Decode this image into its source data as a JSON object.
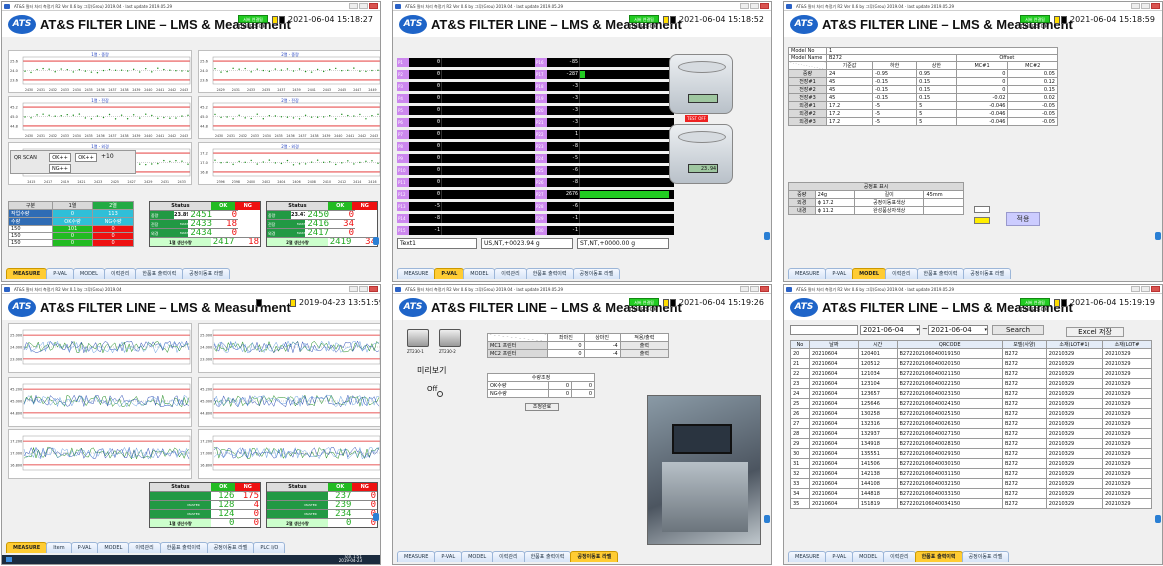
{
  "colors": {
    "accent_blue": "#1e64c8",
    "server_green": "#22cc22",
    "ok_green": "#229944",
    "ng_red": "#ee2222",
    "active_tab": "#ffcc33",
    "pval_label": "#cc88ee"
  },
  "common": {
    "window_title": "AT&S 필터 처리 측정기 R2 Ver 0.6 by 그루(Grou) 2019.04 · last update 2019.05.29",
    "window_title_short": "AT&S 필터 처리 측정기 R2 Ver 0.1 by 그루(Grou) 2019.04",
    "logo_text": "ATS",
    "app_title": "AT&S FILTER LINE – LMS & Measurment",
    "server_status": "서버 연결됨",
    "timer_status": "TIMER3-OK",
    "tabs": [
      "MEASURE",
      "P-VAL",
      "MODEL",
      "이력관리",
      "한품표 출력이력",
      "공정이동표 라벨"
    ]
  },
  "panels": [
    {
      "id": "measure",
      "datetime": "2021-06-04 15:18:27",
      "active_tab": "MEASURE",
      "charts": [
        {
          "title": "1열 - 중량",
          "ymin": "23.6",
          "ymid": "24.0",
          "ymax": "25.6",
          "xticks": [
            "2430",
            "2431",
            "2432",
            "2433",
            "2434",
            "2435",
            "2436",
            "2437",
            "2438",
            "2439",
            "2440",
            "2441",
            "2442",
            "2443"
          ]
        },
        {
          "title": "2열 - 중량",
          "ymin": "23.6",
          "ymid": "24.0",
          "ymax": "25.6",
          "xticks": [
            "2429",
            "2431",
            "2433",
            "2435",
            "2437",
            "2439",
            "2441",
            "2443",
            "2445",
            "2447",
            "2449"
          ]
        },
        {
          "title": "1열 - 전장",
          "ymin": "44.8",
          "ymid": "45.0",
          "ymax": "45.2",
          "xticks": [
            "2430",
            "2431",
            "2432",
            "2433",
            "2434",
            "2435",
            "2436",
            "2437",
            "2438",
            "2439",
            "2440",
            "2441",
            "2442",
            "2443"
          ]
        },
        {
          "title": "2열 - 전장",
          "ymin": "44.8",
          "ymid": "45.0",
          "ymax": "45.2",
          "xticks": [
            "2430",
            "2431",
            "2432",
            "2433",
            "2434",
            "2435",
            "2436",
            "2437",
            "2438",
            "2439",
            "2440",
            "2441",
            "2442",
            "2443"
          ]
        },
        {
          "title": "1열 - 외경",
          "ymin": "16.8",
          "ymid": "17.0",
          "ymax": "17.2",
          "xticks": [
            "2415",
            "2417",
            "2419",
            "2421",
            "2423",
            "2425",
            "2427",
            "2429",
            "2431",
            "2433"
          ]
        },
        {
          "title": "2열 - 외경",
          "ymin": "16.8",
          "ymid": "17.0",
          "ymax": "17.2",
          "xticks": [
            "2396",
            "2398",
            "2400",
            "2402",
            "2404",
            "2406",
            "2408",
            "2410",
            "2412",
            "2414",
            "2416"
          ]
        }
      ],
      "qr": {
        "label": "QR SCAN",
        "ok_btn": "OK++",
        "ok_btn2": "OK++",
        "ng_btn": "NG++",
        "step": "+10"
      },
      "count_table": {
        "headers": [
          "구분",
          "1열",
          "2열"
        ],
        "rows": [
          [
            "작업수량",
            "0",
            "113"
          ],
          [
            "수량",
            "OK수량",
            "NG수량"
          ],
          [
            "150",
            "101",
            "0"
          ],
          [
            "150",
            "0",
            "0"
          ],
          [
            "150",
            "0",
            "0"
          ]
        ]
      },
      "status1": {
        "title": "Status",
        "ok": "OK",
        "ng": "NG",
        "weight": "23.89",
        "rows": [
          [
            "중량",
            "2451",
            "0"
          ],
          [
            "전장",
            "MASTER",
            "2433",
            "18"
          ],
          [
            "외경",
            "MASTER",
            "2434",
            "0"
          ]
        ],
        "footer": "1열 생산수량",
        "total_ok": "2417",
        "total_ng": "18"
      },
      "status2": {
        "title": "Status",
        "ok": "OK",
        "ng": "NG",
        "weight": "23.47",
        "rows": [
          [
            "중량",
            "2450",
            "0"
          ],
          [
            "전장",
            "MASTER",
            "2416",
            "34"
          ],
          [
            "외경",
            "MASTER",
            "2417",
            "0"
          ]
        ],
        "footer": "2열 생산수량",
        "total_ok": "2419",
        "total_ng": "34"
      }
    },
    {
      "id": "pval",
      "datetime": "2021-06-04 15:18:52",
      "active_tab": "P-VAL",
      "left": [
        [
          "P1",
          "0"
        ],
        [
          "P2",
          "0"
        ],
        [
          "P3",
          "0"
        ],
        [
          "P4",
          "0"
        ],
        [
          "P5",
          "0"
        ],
        [
          "P6",
          "0"
        ],
        [
          "P7",
          "0"
        ],
        [
          "P8",
          "0"
        ],
        [
          "P9",
          "0"
        ],
        [
          "P10",
          "0"
        ],
        [
          "P11",
          "0"
        ],
        [
          "P12",
          "0"
        ],
        [
          "P13",
          "-5"
        ],
        [
          "P14",
          "-8"
        ],
        [
          "P15",
          "-1"
        ]
      ],
      "right": [
        [
          "P16",
          "-85"
        ],
        [
          "P17",
          "-287"
        ],
        [
          "P18",
          "-3"
        ],
        [
          "P19",
          "-3"
        ],
        [
          "P20",
          "-3"
        ],
        [
          "P21",
          "-3"
        ],
        [
          "P22",
          "1"
        ],
        [
          "P23",
          "-8"
        ],
        [
          "P24",
          "-5"
        ],
        [
          "P25",
          "-6"
        ],
        [
          "P26",
          "-8"
        ],
        [
          "P27",
          "2676"
        ],
        [
          "P28",
          "-6"
        ],
        [
          "P29",
          "-1"
        ],
        [
          "P30",
          "-1"
        ]
      ],
      "right_fill": [
        0,
        0.05,
        0,
        0,
        0,
        0,
        0,
        0,
        0,
        0,
        0,
        0.95,
        0,
        0,
        0
      ],
      "scale_display_1": "",
      "scale_display_2": "23.94",
      "test_off": "TEST OFF",
      "text1": "Text1",
      "us_value": "US,NT,+0023.94 g",
      "st_value": "ST,NT,+0000.00 g"
    },
    {
      "id": "model",
      "datetime": "2021-06-04 15:18:59",
      "active_tab": "MODEL",
      "model_no_label": "Model No",
      "model_no": "1",
      "model_name_label": "Model Name",
      "model_name": "B272",
      "offset_label": "Offset",
      "spec_headers": [
        "기준값",
        "하한",
        "상한",
        "MC#1",
        "MC#2"
      ],
      "spec_rows": [
        [
          "중량",
          "24",
          "-0.95",
          "0.95",
          "0",
          "0.05"
        ],
        [
          "전장#1",
          "45",
          "-0.15",
          "0.15",
          "0",
          "0.12"
        ],
        [
          "전장#2",
          "45",
          "-0.15",
          "0.15",
          "0",
          "0.15"
        ],
        [
          "전장#3",
          "45",
          "-0.15",
          "0.15",
          "-0.02",
          "0.02"
        ],
        [
          "외경#1",
          "17.2",
          "-5",
          "5",
          "-0.046",
          "-0.05"
        ],
        [
          "외경#2",
          "17.2",
          "-5",
          "5",
          "-0.046",
          "-0.05"
        ],
        [
          "외경#3",
          "17.2",
          "-5",
          "5",
          "-0.046",
          "-0.05"
        ]
      ],
      "label_title": "공정표 표시",
      "label_rows": [
        [
          "중량",
          "24g",
          "길이",
          "45mm"
        ],
        [
          "외경",
          "ϕ 17.2",
          "공정이동표색상",
          ""
        ],
        [
          "내경",
          "ϕ 11.2",
          "완성품상자색상",
          ""
        ]
      ],
      "apply_btn": "적용"
    },
    {
      "id": "trend",
      "datetime": "2019-04-23 13:51:59",
      "active_tab": "MEASURE",
      "tabs": [
        "MEASURE",
        "Item",
        "P-VAL",
        "MODEL",
        "이력관리",
        "한품표 출력이력",
        "공정이동표 라벨",
        "PLC I/O"
      ],
      "charts": [
        {
          "ymin": "23.000",
          "ymid": "24.000",
          "ymax": "25.000"
        },
        {
          "ymin": "23.000",
          "ymid": "24.000",
          "ymax": "25.000"
        },
        {
          "ymin": "44.800",
          "ymid": "45.000",
          "ymax": "45.200"
        },
        {
          "ymin": "44.800",
          "ymid": "45.000",
          "ymax": "45.200"
        },
        {
          "ymin": "16.800",
          "ymid": "17.000",
          "ymax": "17.200"
        },
        {
          "ymin": "16.800",
          "ymid": "17.000",
          "ymax": "17.200"
        }
      ],
      "status1": {
        "title": "Status",
        "ok": "OK",
        "ng": "NG",
        "rows": [
          [
            "126",
            "175"
          ],
          [
            "MASTER",
            "128",
            "4"
          ],
          [
            "MASTER",
            "124",
            "0"
          ]
        ],
        "footer": "1열 생산수량",
        "total_ok": "0",
        "total_ng": "0"
      },
      "status2": {
        "title": "Status",
        "ok": "OK",
        "ng": "NG",
        "rows": [
          [
            "237",
            "0"
          ],
          [
            "MASTER",
            "239",
            "0"
          ],
          [
            "MASTER",
            "234",
            "0"
          ]
        ],
        "footer": "2열 생산수량",
        "total_ok": "0",
        "total_ng": "0"
      },
      "clock_time": "오후 1:51",
      "clock_date": "2019-04-23"
    },
    {
      "id": "label",
      "datetime": "2021-06-04 15:19:26",
      "active_tab": "공정이동표 라벨",
      "printers": [
        "ZT230-1",
        "ZT230-2"
      ],
      "preview_label": "미리보기",
      "off_label": "Off",
      "print_headers": [
        "",
        "좌마진",
        "상마진",
        "적용/출력"
      ],
      "print_rows": [
        [
          "MC1 프린터",
          "0",
          "-4",
          "출력"
        ],
        [
          "MC2 프린터",
          "0",
          "-4",
          "출력"
        ]
      ],
      "qty_title": "수량조정",
      "qty_rows": [
        [
          "OK수량",
          "0",
          "0"
        ],
        [
          "NG수량",
          "0",
          "0"
        ]
      ],
      "qty_btn": "조정완료"
    },
    {
      "id": "history",
      "datetime": "2021-06-04 15:19:19",
      "active_tab": "한품표 출력이력",
      "date_from": "2021-06-04",
      "date_to": "2021-06-04",
      "search_btn": "Search",
      "excel_btn": "Excel 저장",
      "headers": [
        "No",
        "날짜",
        "시간",
        "QRCODE",
        "모델(사양)",
        "소재(LOT#1)",
        "소재(LOT#"
      ],
      "rows": [
        [
          "20",
          "20210604",
          "120401",
          "B272202106040019150",
          "B272",
          "20210329",
          "20210329"
        ],
        [
          "21",
          "20210604",
          "120512",
          "B272202106040020150",
          "B272",
          "20210329",
          "20210329"
        ],
        [
          "22",
          "20210604",
          "121034",
          "B272202106040021150",
          "B272",
          "20210329",
          "20210329"
        ],
        [
          "23",
          "20210604",
          "123104",
          "B272202106040022150",
          "B272",
          "20210329",
          "20210329"
        ],
        [
          "24",
          "20210604",
          "123657",
          "B272202106040023150",
          "B272",
          "20210329",
          "20210329"
        ],
        [
          "25",
          "20210604",
          "125646",
          "B272202106040024150",
          "B272",
          "20210329",
          "20210329"
        ],
        [
          "26",
          "20210604",
          "130258",
          "B272202106040025150",
          "B272",
          "20210329",
          "20210329"
        ],
        [
          "27",
          "20210604",
          "132316",
          "B272202106040026150",
          "B272",
          "20210329",
          "20210329"
        ],
        [
          "28",
          "20210604",
          "132937",
          "B272202106040027150",
          "B272",
          "20210329",
          "20210329"
        ],
        [
          "29",
          "20210604",
          "134918",
          "B272202106040028150",
          "B272",
          "20210329",
          "20210329"
        ],
        [
          "30",
          "20210604",
          "135551",
          "B272202106040029150",
          "B272",
          "20210329",
          "20210329"
        ],
        [
          "31",
          "20210604",
          "141506",
          "B272202106040030150",
          "B272",
          "20210329",
          "20210329"
        ],
        [
          "32",
          "20210604",
          "142138",
          "B272202106040031150",
          "B272",
          "20210329",
          "20210329"
        ],
        [
          "33",
          "20210604",
          "144108",
          "B272202106040032150",
          "B272",
          "20210329",
          "20210329"
        ],
        [
          "34",
          "20210604",
          "144818",
          "B272202106040033150",
          "B272",
          "20210329",
          "20210329"
        ],
        [
          "35",
          "20210604",
          "151819",
          "B272202106040034150",
          "B272",
          "20210329",
          "20210329"
        ]
      ]
    }
  ]
}
